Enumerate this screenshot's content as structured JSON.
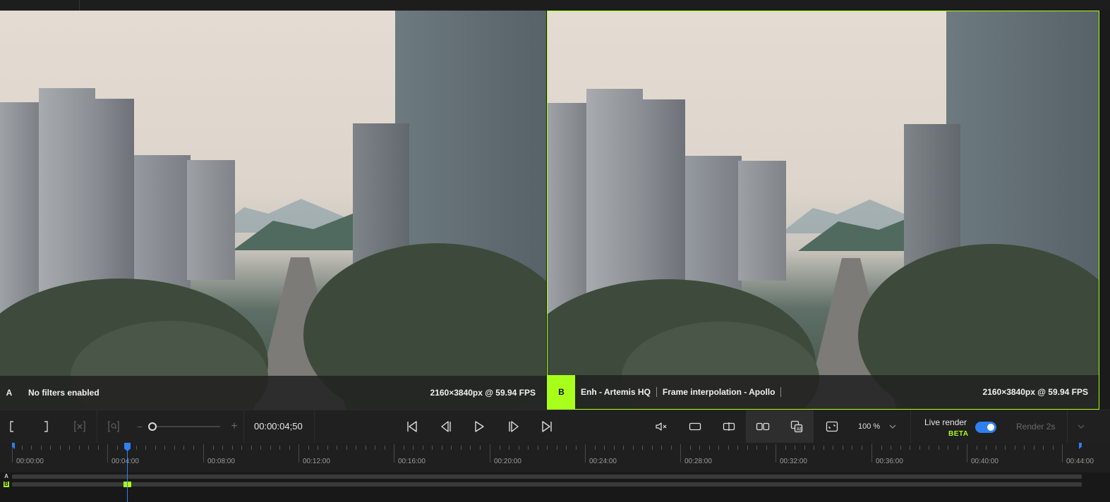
{
  "preview": {
    "a": {
      "letter": "A",
      "filters": "No filters enabled",
      "resolution": "2160×3840px @ 59.94 FPS"
    },
    "b": {
      "letter": "B",
      "enhancement": "Enh - Artemis HQ",
      "interpolation": "Frame interpolation - Apollo",
      "resolution": "2160×3840px @ 59.94 FPS"
    }
  },
  "controls": {
    "set_in_icon": "bracket-left-icon",
    "set_out_icon": "bracket-right-icon",
    "clear_range_icon": "clear-range-icon",
    "zoom_fit_icon": "zoom-fit-icon",
    "zoom_minus": "−",
    "zoom_plus": "+",
    "timecode": "00:00:04;50",
    "zoom_percent": "100 %",
    "live_render_label": "Live render",
    "beta_label": "BETA",
    "live_render_enabled": true,
    "render_button": "Render 2s"
  },
  "timeline": {
    "labels": [
      "00:00:00",
      "00:04:00",
      "00:08:00",
      "00:12:00",
      "00:16:00",
      "00:20:00",
      "00:24:00",
      "00:28:00",
      "00:32:00",
      "00:36:00",
      "00:40:00",
      "00:44:00"
    ],
    "track_a_label": "A",
    "track_b_label": "B"
  },
  "colors": {
    "accent_green": "#a8ff1a",
    "accent_blue": "#2f80ed"
  }
}
